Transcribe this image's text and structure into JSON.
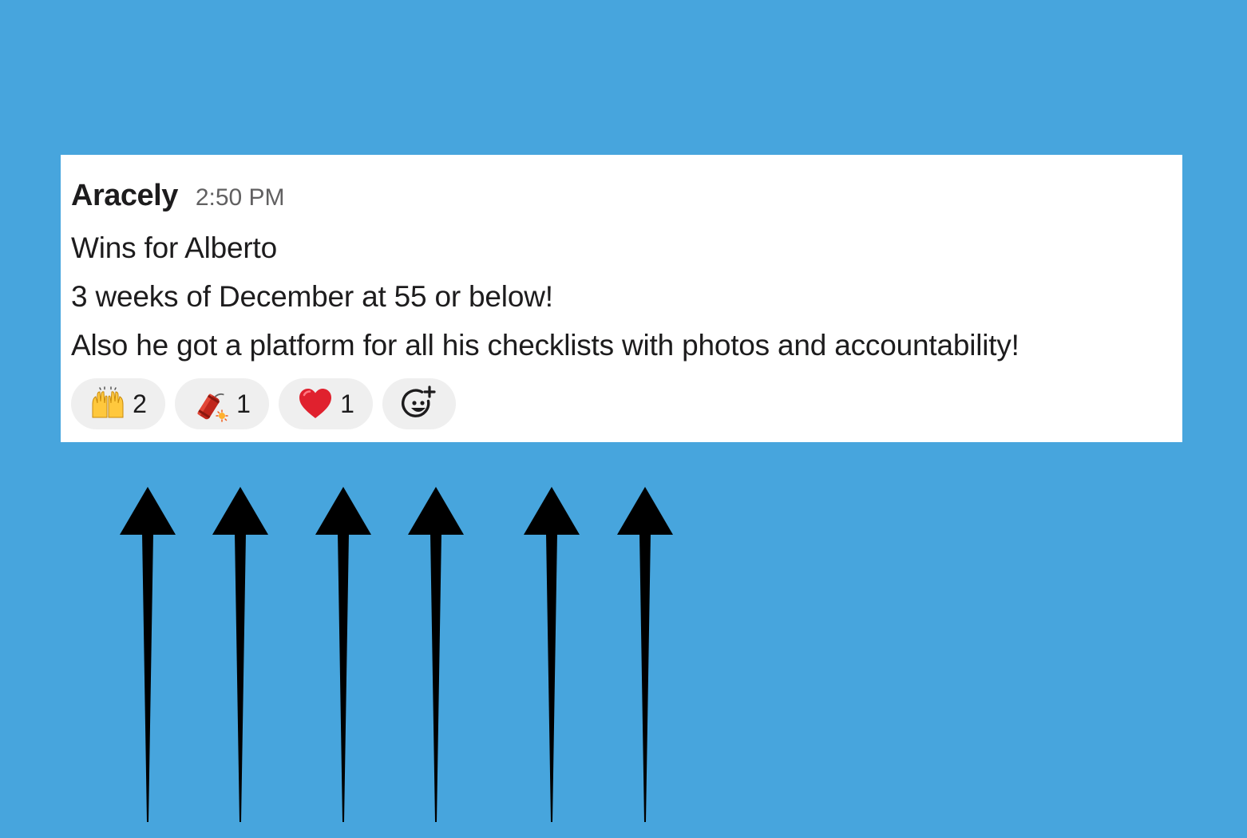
{
  "colors": {
    "background": "#47a5dd",
    "card": "#ffffff",
    "pill": "#efefef",
    "arrow": "#000000"
  },
  "message": {
    "author": "Aracely",
    "time": "2:50 PM",
    "lines": [
      "Wins for Alberto",
      "3 weeks of December at 55 or below!",
      "Also he got a platform for all his checklists with photos and accountability!"
    ]
  },
  "reactions": [
    {
      "icon": "raised-hands-icon",
      "count": "2"
    },
    {
      "icon": "firecracker-icon",
      "count": "1"
    },
    {
      "icon": "red-heart-icon",
      "count": "1"
    }
  ],
  "add_reaction": {
    "icon": "add-reaction-icon"
  }
}
